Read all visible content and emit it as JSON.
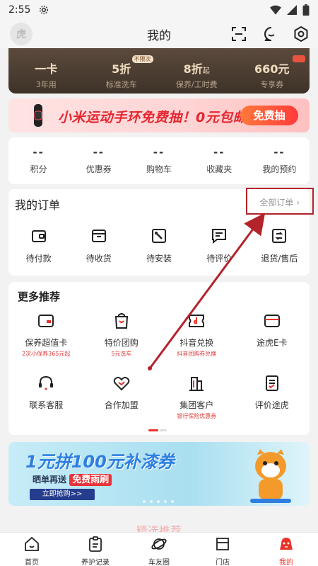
{
  "status_bar": {
    "time": "2:55"
  },
  "header": {
    "title": "我的",
    "avatar_text": "虎"
  },
  "member_card": [
    {
      "main": "一卡",
      "sub": "3年用"
    },
    {
      "main": "5折",
      "sub": "标准洗车",
      "tag": "不限次"
    },
    {
      "main": "8折",
      "suffix": "起",
      "sub": "保养/工时费"
    },
    {
      "main": "660元",
      "sub": "专享券"
    }
  ],
  "promo": {
    "text": "小米运动手环免费抽！0元包邮！",
    "button": "免费抽"
  },
  "stats": [
    {
      "value": "--",
      "label": "积分"
    },
    {
      "value": "--",
      "label": "优惠券"
    },
    {
      "value": "--",
      "label": "购物车"
    },
    {
      "value": "--",
      "label": "收藏夹"
    },
    {
      "value": "--",
      "label": "我的预约"
    }
  ],
  "orders": {
    "title": "我的订单",
    "view_all": "全部订单",
    "items": [
      {
        "label": "待付款",
        "icon": "wallet-icon"
      },
      {
        "label": "待收货",
        "icon": "box-icon"
      },
      {
        "label": "待安装",
        "icon": "wrench-icon"
      },
      {
        "label": "待评价",
        "icon": "comment-icon"
      },
      {
        "label": "退货/售后",
        "icon": "return-icon"
      }
    ]
  },
  "more": {
    "title": "更多推荐",
    "items": [
      {
        "label": "保养超值卡",
        "sub": "2次小保养365元起",
        "icon": "card-icon"
      },
      {
        "label": "特价团购",
        "sub": "5元洗车",
        "icon": "shopping-bag-icon"
      },
      {
        "label": "抖音兑换",
        "sub": "抖音团购券兑换",
        "icon": "tiktok-ticket-icon"
      },
      {
        "label": "途虎E卡",
        "sub": "",
        "icon": "ecard-icon"
      },
      {
        "label": "联系客服",
        "sub": "",
        "icon": "headset-icon"
      },
      {
        "label": "合作加盟",
        "sub": "",
        "icon": "handshake-icon"
      },
      {
        "label": "集团客户",
        "sub": "银行保险优惠券",
        "icon": "building-icon"
      },
      {
        "label": "评价途虎",
        "sub": "",
        "icon": "review-icon"
      }
    ]
  },
  "banner": {
    "title": "1元拼100元补漆券",
    "sub_prefix": "晒单再送",
    "sub_highlight": "免费雨刷",
    "button": "立即抢购>>"
  },
  "peek_text": "精选推荐",
  "bottom_nav": [
    {
      "label": "首页",
      "icon": "home-icon"
    },
    {
      "label": "养护记录",
      "icon": "clipboard-icon"
    },
    {
      "label": "车友圈",
      "icon": "planet-icon"
    },
    {
      "label": "门店",
      "icon": "store-icon"
    },
    {
      "label": "我的",
      "icon": "user-icon",
      "active": true
    }
  ],
  "colors": {
    "accent": "#e7332a",
    "annotation": "#b3232a",
    "member_bg": "#4a3c30"
  }
}
